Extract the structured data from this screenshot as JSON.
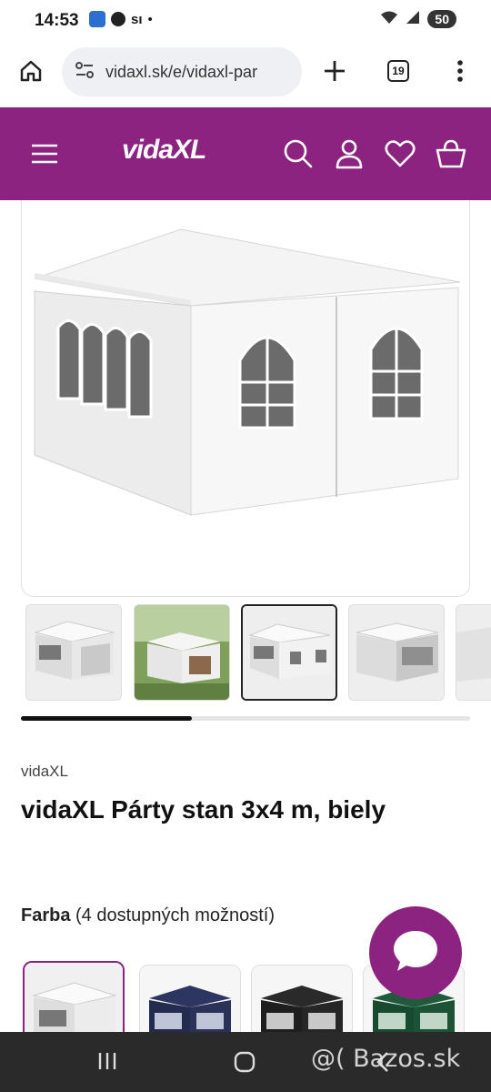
{
  "status": {
    "time": "14:53",
    "carrier": "sı",
    "battery": "50"
  },
  "browser": {
    "url": "vidaxl.sk/e/vidaxl-par",
    "tab_count": "19"
  },
  "site": {
    "logo": "vidaXL",
    "accent": "#8d2380"
  },
  "product": {
    "brand": "vidaXL",
    "title": "vidaXL Párty stan 3x4 m, biely",
    "color_label_bold": "Farba",
    "color_label_rest": " (4 dostupných možností)",
    "gallery_progress": 0.38
  },
  "thumbnails": [
    "tent-open-sides",
    "tent-in-garden",
    "tent-front",
    "tent-open-front",
    "tent-partial"
  ],
  "swatches": [
    "white",
    "navy",
    "black",
    "green"
  ],
  "watermark": "@( Bazos.sk"
}
